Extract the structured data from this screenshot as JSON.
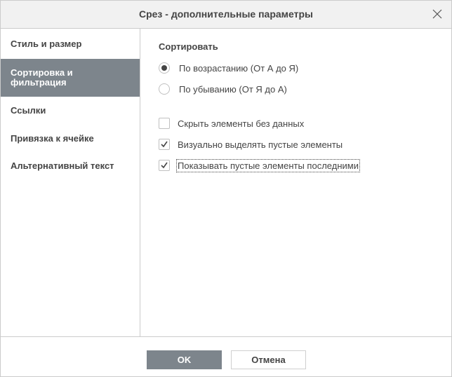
{
  "dialog": {
    "title": "Срез - дополнительные параметры"
  },
  "sidebar": {
    "items": [
      {
        "label": "Стиль и размер",
        "active": false
      },
      {
        "label": "Сортировка и фильтрация",
        "active": true
      },
      {
        "label": "Ссылки",
        "active": false
      },
      {
        "label": "Привязка к ячейке",
        "active": false
      },
      {
        "label": "Альтернативный текст",
        "active": false
      }
    ]
  },
  "content": {
    "sort_title": "Сортировать",
    "sort_options": [
      {
        "label": "По возрастанию (От А до Я)",
        "checked": true
      },
      {
        "label": "По убыванию (От Я до А)",
        "checked": false
      }
    ],
    "checkboxes": [
      {
        "label": "Скрыть элементы без данных",
        "checked": false
      },
      {
        "label": "Визуально выделять пустые элементы",
        "checked": true
      },
      {
        "label": "Показывать пустые элементы последними",
        "checked": true
      }
    ]
  },
  "footer": {
    "ok_label": "OK",
    "cancel_label": "Отмена"
  },
  "colors": {
    "active_bg": "#7d858c",
    "header_bg": "#f1f1f1",
    "border": "#cbcbcb"
  },
  "icons": {
    "close": "close-icon",
    "checkmark": "checkmark-icon"
  }
}
